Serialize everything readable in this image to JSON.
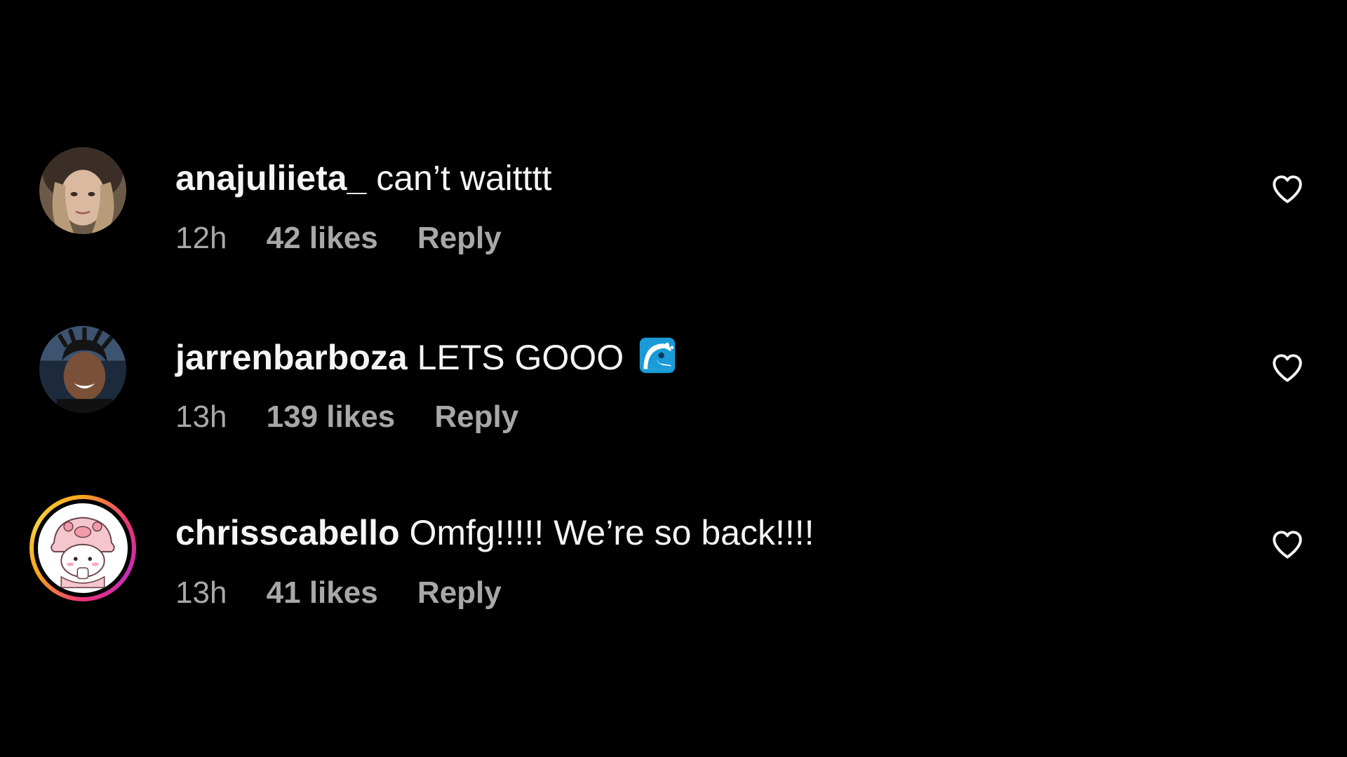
{
  "comments": [
    {
      "username": "anajuliieta_",
      "text": "can’t waitttt",
      "emoji": "",
      "time": "12h",
      "likes": "42 likes",
      "reply": "Reply",
      "has_story_ring": false
    },
    {
      "username": "jarrenbarboza",
      "text": "LETS GOOO",
      "emoji": "water-wave-emoji",
      "time": "13h",
      "likes": "139 likes",
      "reply": "Reply",
      "has_story_ring": false
    },
    {
      "username": "chrisscabello",
      "text": "Omfg!!!!! We’re so back!!!!",
      "emoji": "",
      "time": "13h",
      "likes": "41 likes",
      "reply": "Reply",
      "has_story_ring": true
    }
  ],
  "icons": {
    "like": "heart-outline-icon"
  },
  "colors": {
    "background": "#000000",
    "primary_text": "#f5f5f5",
    "secondary_text": "#a8a8a8",
    "story_ring_start": "#f9a51c",
    "story_ring_end": "#c92bb7"
  }
}
